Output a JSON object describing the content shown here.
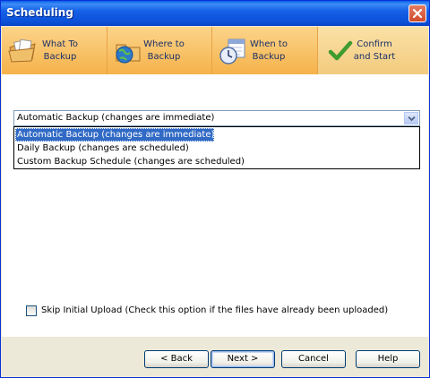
{
  "window": {
    "title": "Scheduling"
  },
  "tabs": [
    {
      "label": "What To\nBackup",
      "icon": "files-folder-icon"
    },
    {
      "label": "Where to\nBackup",
      "icon": "globe-folder-icon"
    },
    {
      "label": "When to\nBackup",
      "icon": "clock-calendar-icon"
    },
    {
      "label": "Confirm\nand Start",
      "icon": "checkmark-icon"
    }
  ],
  "schedule": {
    "selected": "Automatic Backup (changes are immediate)",
    "options": [
      "Automatic Backup (changes are immediate)",
      "Daily Backup (changes are scheduled)",
      "Custom Backup Schedule (changes are scheduled)"
    ]
  },
  "skip_upload": {
    "label": "Skip Initial Upload (Check this option if the files have already been uploaded)",
    "checked": false
  },
  "buttons": {
    "back": "< Back",
    "next": "Next >",
    "cancel": "Cancel",
    "help": "Help"
  },
  "colors": {
    "titlebar": "#0a5fe8",
    "tab_bg": "#f5b24a",
    "selection": "#316ac5"
  }
}
